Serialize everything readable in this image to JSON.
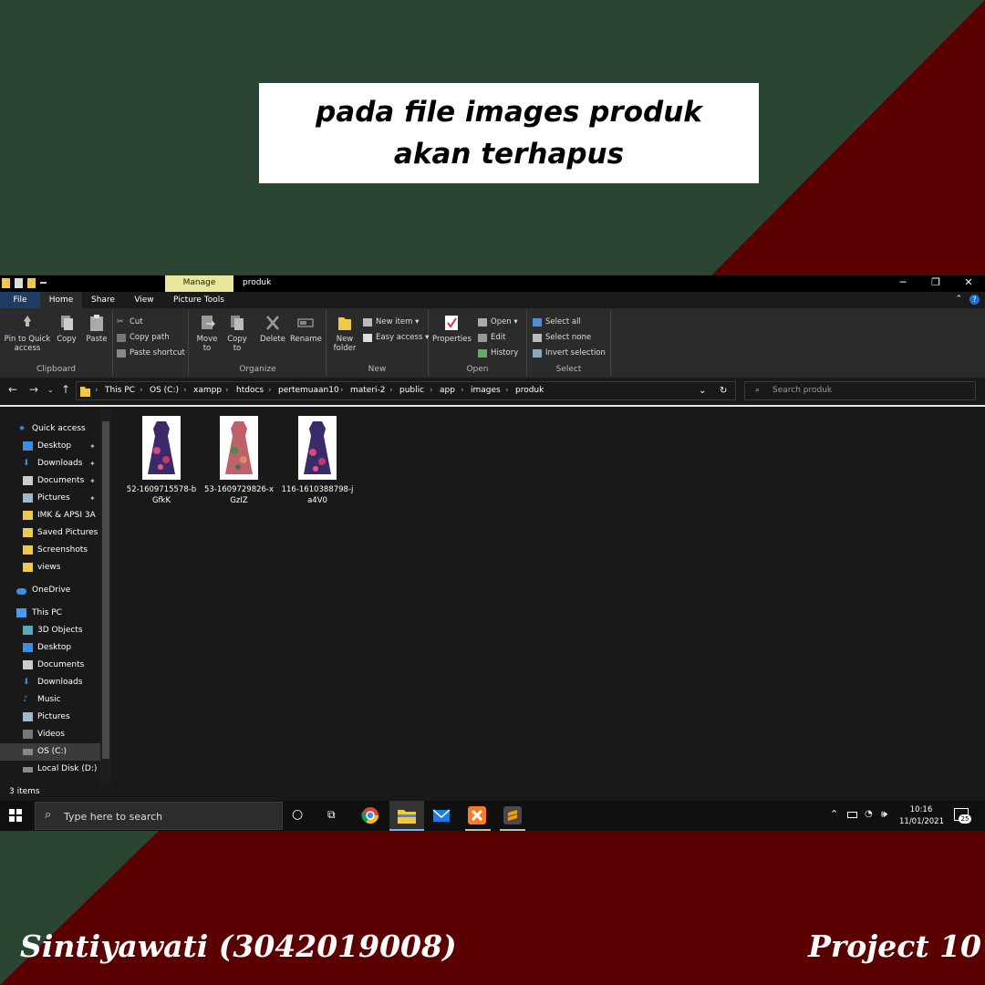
{
  "caption": "pada file images produk akan terhapus",
  "footer": {
    "author": "Sintiyawati (3042019008)",
    "project": "Project 10"
  },
  "window": {
    "title": "produk",
    "manage_tab": "Manage",
    "tabs": [
      "File",
      "Home",
      "Share",
      "View",
      "Picture Tools"
    ]
  },
  "ribbon": {
    "clipboard": {
      "label": "Clipboard",
      "pin": "Pin to Quick access",
      "copy": "Copy",
      "paste": "Paste",
      "cut": "Cut",
      "copy_path": "Copy path",
      "paste_shortcut": "Paste shortcut"
    },
    "organize": {
      "label": "Organize",
      "move_to": "Move to",
      "copy_to": "Copy to",
      "delete": "Delete",
      "rename": "Rename"
    },
    "new": {
      "label": "New",
      "new_folder": "New folder",
      "new_item": "New item",
      "easy_access": "Easy access"
    },
    "open": {
      "label": "Open",
      "properties": "Properties",
      "open": "Open",
      "edit": "Edit",
      "history": "History"
    },
    "select": {
      "label": "Select",
      "select_all": "Select all",
      "select_none": "Select none",
      "invert": "Invert selection"
    }
  },
  "address": {
    "crumbs": [
      "This PC",
      "OS (C:)",
      "xampp",
      "htdocs",
      "pertemuaan10",
      "materi-2",
      "public",
      "app",
      "images",
      "produk"
    ],
    "search_placeholder": "Search produk"
  },
  "nav": {
    "quick_access": "Quick access",
    "quick_items": [
      "Desktop",
      "Downloads",
      "Documents",
      "Pictures",
      "IMK & APSI 3A",
      "Saved Pictures",
      "Screenshots",
      "views"
    ],
    "onedrive": "OneDrive",
    "this_pc": "This PC",
    "pc_items": [
      "3D Objects",
      "Desktop",
      "Documents",
      "Downloads",
      "Music",
      "Pictures",
      "Videos",
      "OS (C:)",
      "Local Disk (D:)"
    ]
  },
  "files": [
    {
      "name": "52-1609715578-bGfkK",
      "color": "#3a2a6a"
    },
    {
      "name": "53-1609729826-xGzIZ",
      "color": "#c0606a"
    },
    {
      "name": "116-1610388798-ja4V0",
      "color": "#3a2a6a"
    }
  ],
  "status": {
    "items": "3 items"
  },
  "taskbar": {
    "search_placeholder": "Type here to search",
    "time": "10:16",
    "date": "11/01/2021",
    "notifications": "25"
  },
  "colors": {
    "bg_green": "#2b4533",
    "bg_red": "#5a0000",
    "manage_tab": "#e7e79b",
    "file_tab": "#1f3c64",
    "folder": "#f0c84a"
  }
}
